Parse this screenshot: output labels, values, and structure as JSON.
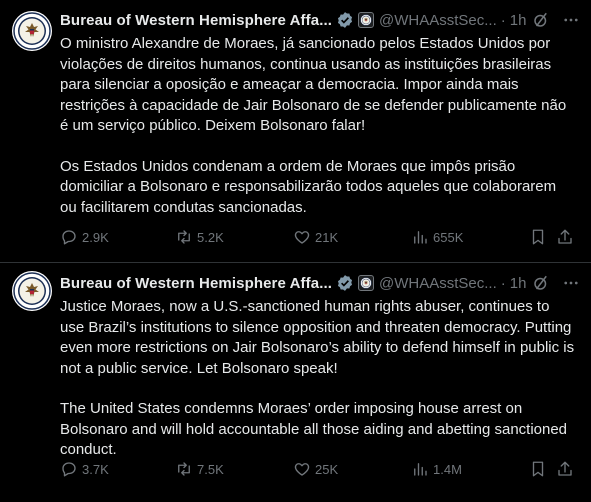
{
  "colors": {
    "background": "#000000",
    "text": "#e7e9ea",
    "muted": "#71767b",
    "verified": "#829aab",
    "divider": "#2f3336"
  },
  "tweets": [
    {
      "author_name": "Bureau of Western Hemisphere Affa...",
      "handle": "@WHAAsstSec...",
      "separator": "·",
      "time": "1h",
      "paragraphs": [
        "O ministro Alexandre de Moraes, já sancionado pelos Estados Unidos por violações de direitos humanos, continua usando as instituições brasileiras para silenciar a oposição e ameaçar a democracia. Impor ainda mais restrições à capacidade de Jair Bolsonaro de se defender publicamente não é um serviço público. Deixem Bolsonaro falar!",
        "Os Estados Unidos condenam a ordem de Moraes que impôs prisão domiciliar a Bolsonaro e responsabilizarão todos aqueles que colaborarem ou facilitarem condutas sancionadas."
      ],
      "replies": "2.9K",
      "reposts": "5.2K",
      "likes": "21K",
      "views": "655K"
    },
    {
      "author_name": "Bureau of Western Hemisphere Affa...",
      "handle": "@WHAAsstSec...",
      "separator": "·",
      "time": "1h",
      "paragraphs": [
        "Justice Moraes, now a U.S.-sanctioned human rights abuser, continues to use Brazil’s institutions to silence opposition and threaten democracy. Putting even more restrictions on Jair Bolsonaro’s ability to defend himself in public is not a public service. Let Bolsonaro speak!",
        "The United States condemns Moraes’ order imposing house arrest on Bolsonaro and will hold accountable all those aiding and abetting sanctioned conduct."
      ],
      "replies": "3.7K",
      "reposts": "7.5K",
      "likes": "25K",
      "views": "1.4M"
    }
  ],
  "icons": [
    "seal-avatar",
    "verified-badge-icon",
    "affiliation-seal-icon",
    "grok-icon",
    "more-icon",
    "reply-icon",
    "repost-icon",
    "like-icon",
    "views-icon",
    "bookmark-icon",
    "share-icon"
  ]
}
